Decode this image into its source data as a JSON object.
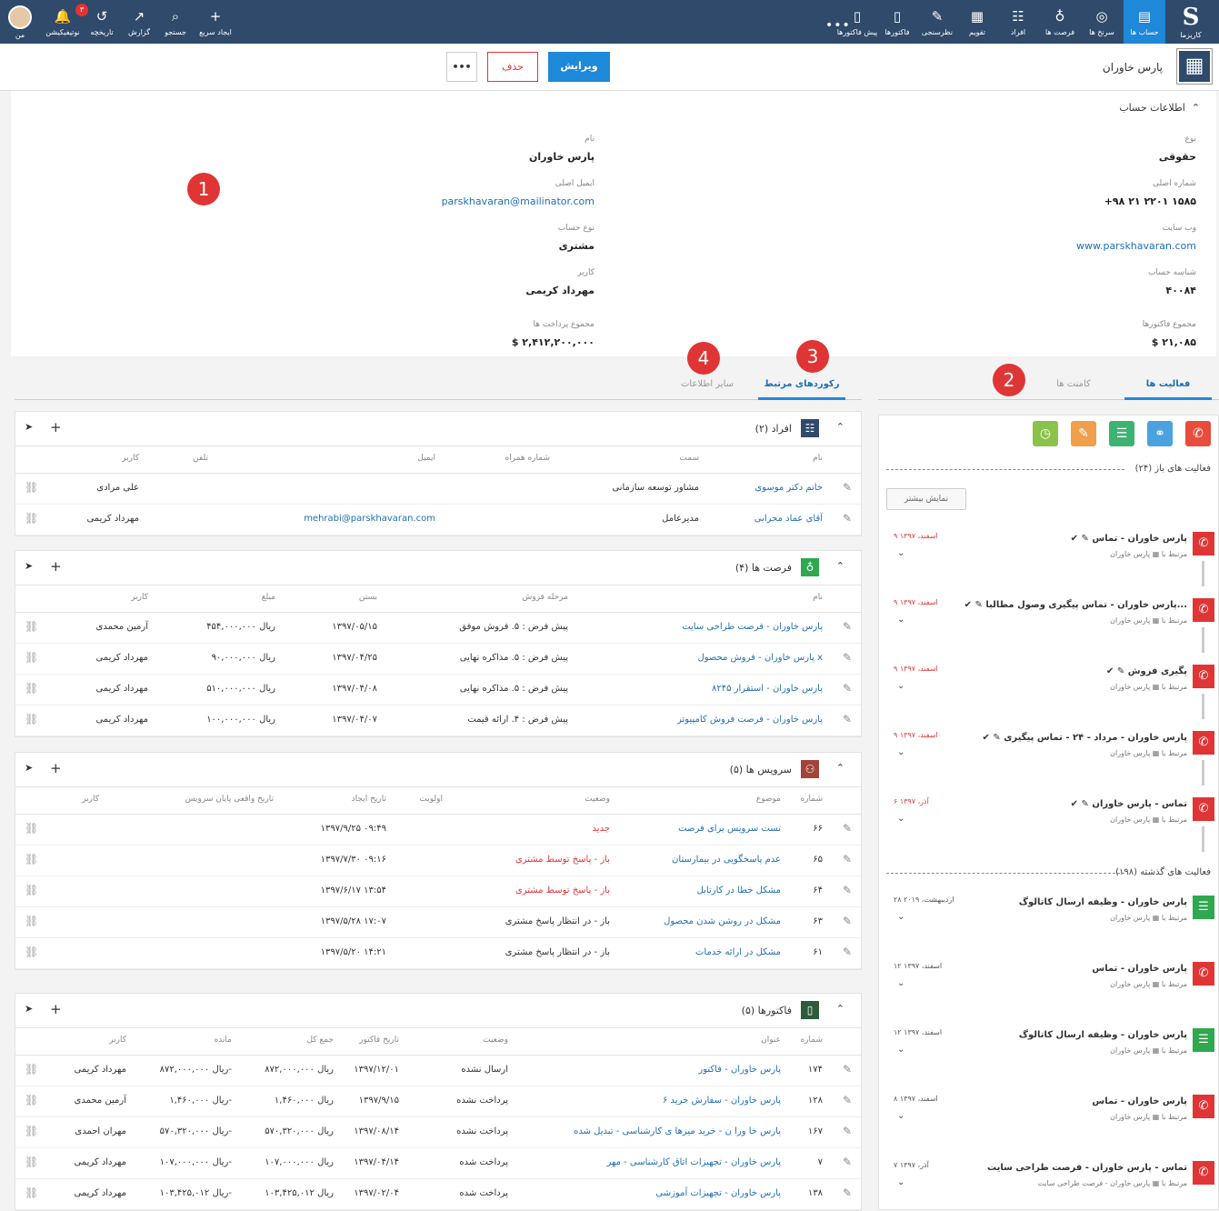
{
  "nav_right": [
    {
      "label": "کاریزما",
      "icon": "S"
    },
    {
      "label": "حساب ها",
      "icon": "▤",
      "active": true
    },
    {
      "label": "سرنخ ها",
      "icon": "◎"
    },
    {
      "label": "فرصت ها",
      "icon": "♁"
    },
    {
      "label": "افراد",
      "icon": "☷"
    },
    {
      "label": "تقویم",
      "icon": "▦"
    },
    {
      "label": "نظرسنجی",
      "icon": "✎"
    },
    {
      "label": "فاکتورها",
      "icon": "▯"
    },
    {
      "label": "پیش فاکتورها",
      "icon": "▯"
    }
  ],
  "nav_more": "•••",
  "nav_left": [
    {
      "label": "ایجاد سریع",
      "icon": "+"
    },
    {
      "label": "جستجو",
      "icon": "⌕"
    },
    {
      "label": "گزارش",
      "icon": "↗"
    },
    {
      "label": "تاریخچه",
      "icon": "↺"
    },
    {
      "label": "نوتیفیکیشن",
      "icon": "🔔",
      "badge": "۳"
    },
    {
      "label": "من",
      "icon": ""
    }
  ],
  "account": {
    "name": "پارس خاوران",
    "edit_label": "ویرایش",
    "delete_label": "حذف",
    "more_label": "•••"
  },
  "info": {
    "section_title": "اطلاعات حساب",
    "right_fields": [
      {
        "label": "نوع",
        "value": "حقوقی",
        "link": false
      },
      {
        "label": "شماره اصلی",
        "value": "+۹۸ ۲۱ ۲۲۰۱ ۱۵۸۵",
        "link": false
      },
      {
        "label": "وب سایت",
        "value": "www.parskhavaran.com",
        "link": true
      },
      {
        "label": "شناسه حساب",
        "value": "۴۰۰۸۴",
        "link": false
      },
      {
        "label": "مجموع فاکتورها",
        "value": "$ ۲۱,۰۸۵",
        "link": false
      }
    ],
    "left_fields": [
      {
        "label": "نام",
        "value": "پارس خاوران",
        "link": false
      },
      {
        "label": "ایمیل اصلی",
        "value": "parskhavaran@mailinator.com",
        "link": true
      },
      {
        "label": "نوع حساب",
        "value": "مشتری",
        "link": false
      },
      {
        "label": "کاربر",
        "value": "مهرداد کریمی",
        "link": false
      },
      {
        "label": "مجموع پرداخت ها",
        "value": "$ ۲,۴۱۲,۲۰۰,۰۰۰",
        "link": false
      }
    ]
  },
  "markers": [
    "1",
    "2",
    "3",
    "4"
  ],
  "tabs_right": {
    "activities": "فعالیت ها",
    "comments": "کامنت ها"
  },
  "tabs_left": {
    "related": "رکوردهای مرتبط",
    "other": "سایر اطلاعات"
  },
  "panels": {
    "people": {
      "title": "افراد (۲)",
      "cols": [
        "نام",
        "سمت",
        "شماره همراه",
        "ایمیل",
        "تلفن",
        "کاربر"
      ],
      "rows": [
        [
          "خانم دکتر موسوی",
          "مشاور توسعه سازمانی",
          "",
          "",
          "",
          "علی مرادی"
        ],
        [
          "آقای عماد محرابی",
          "مدیرعامل",
          "",
          "mehrabi@parskhavaran.com",
          "",
          "مهرداد کریمی"
        ]
      ]
    },
    "opps": {
      "title": "فرصت ها (۴)",
      "cols": [
        "نام",
        "مرحله فروش",
        "بستن",
        "مبلغ",
        "کاربر"
      ],
      "rows": [
        [
          "پارس خاوران - فرصت طراحی سایت",
          "پیش فرض : ۵. فروش موفق",
          "۱۳۹۷/۰۵/۱۵",
          "ریال ۴۵۴,۰۰۰,۰۰۰",
          "آرمین محمدی"
        ],
        [
          "پارس خاوران - فروش محصول x",
          "پیش فرض : ۵. مذاکره نهایی",
          "۱۳۹۷/۰۴/۲۵",
          "ریال ۹۰,۰۰۰,۰۰۰",
          "مهرداد کریمی"
        ],
        [
          "پارس خاوران - استقرار ۸۲۴۵",
          "پیش فرض : ۵. مذاکره نهایی",
          "۱۳۹۷/۰۴/۰۸",
          "ریال ۵۱۰,۰۰۰,۰۰۰",
          "مهرداد کریمی"
        ],
        [
          "پارس خاوران - فرصت فروش کامپیوتر",
          "پیش فرض : ۴. ارائه قیمت",
          "۱۳۹۷/۰۴/۰۷",
          "ریال ۱۰۰,۰۰۰,۰۰۰",
          "مهرداد کریمی"
        ]
      ]
    },
    "services": {
      "title": "سرویس ها (۵)",
      "cols": [
        "شماره",
        "موضوع",
        "وضعیت",
        "اولویت",
        "تاریخ ایجاد",
        "تاریخ واقعی پایان سرویس",
        "کاربر"
      ],
      "rows": [
        [
          "۶۶",
          "تست سرویس برای فرصت",
          "جدید",
          "",
          "۱۳۹۷/۹/۲۵ ۰۹:۴۹",
          "",
          ""
        ],
        [
          "۶۵",
          "عدم پاسخگویی در بیمارستان",
          "باز - پاسخ توسط مشتری",
          "",
          "۱۳۹۷/۷/۳۰ ۰۹:۱۶",
          "",
          ""
        ],
        [
          "۶۴",
          "مشکل خطا در کارتابل",
          "باز - پاسخ توسط مشتری",
          "",
          "۱۳۹۷/۶/۱۷ ۱۳:۵۴",
          "",
          ""
        ],
        [
          "۶۳",
          "مشکل در روشن شدن محصول",
          "باز - در انتظار پاسخ مشتری",
          "",
          "۱۳۹۷/۵/۲۸ ۱۷:۰۷",
          "",
          ""
        ],
        [
          "۶۱",
          "مشکل در ارائه خدمات",
          "باز - در انتظار پاسخ مشتری",
          "",
          "۱۳۹۷/۵/۲۰ ۱۴:۲۱",
          "",
          ""
        ]
      ],
      "red_status": [
        true,
        true,
        true,
        false,
        false
      ]
    },
    "invoices": {
      "title": "فاکتورها (۵)",
      "cols": [
        "شماره",
        "عنوان",
        "وضعیت",
        "تاریخ فاکتور",
        "جمع کل",
        "مانده",
        "کاربر"
      ],
      "rows": [
        [
          "۱۷۴",
          "پارس خاوران - فاکتور",
          "ارسال نشده",
          "۱۳۹۷/۱۲/۰۱",
          "ریال ۸۷۲,۰۰۰,۰۰۰",
          "ریال ۸۷۲,۰۰۰,۰۰۰-",
          "مهرداد کریمی"
        ],
        [
          "۱۲۸",
          "پارس خاوران - سفارش خرید ۶",
          "پرداخت نشده",
          "۱۳۹۷/۹/۱۵",
          "ریال ۱,۴۶۰,۰۰۰",
          "ریال ۱,۴۶۰,۰۰۰-",
          "آرمین محمدی"
        ],
        [
          "۱۶۷",
          "پارس خا ورا ن - خرید میزها ی کارشناسی - تبدیل شده",
          "پرداخت نشده",
          "۱۳۹۷/۰۸/۱۴",
          "ریال ۵۷۰,۳۲۰,۰۰۰",
          "ریال ۵۷۰,۳۲۰,۰۰۰-",
          "مهران احمدی"
        ],
        [
          "۷",
          "پارس خاوران - تجهیزات اتاق کارشناسی - مهر",
          "پرداخت شده",
          "۱۳۹۷/۰۴/۱۴",
          "ریال ۱۰۷,۰۰۰,۰۰۰",
          "ریال ۱۰۷,۰۰۰,۰۰۰-",
          "مهرداد کریمی"
        ],
        [
          "۱۳۸",
          "پارس خاوران - تجهیزات آموزشی",
          "پرداخت شده",
          "۱۳۹۷/۰۲/۰۴",
          "ریال ۱۰۳,۴۲۵,۰۱۲",
          "ریال ۱۰۳,۴۲۵,۰۱۲-",
          "مهرداد کریمی"
        ]
      ]
    }
  },
  "activities": {
    "open_title": "فعالیت های باز (۲۴)",
    "show_more": "نمایش بیشتر",
    "past_title": "فعالیت های گذشته (۱۹۸)",
    "related_label": "مرتبط با",
    "open": [
      {
        "title": "پارس خاوران - تماس",
        "related": "پارس خاوران",
        "date": "۹ اسفند، ۱۳۹۷",
        "type": "call"
      },
      {
        "title": "پارس خاوران - تماس پیگیری وصول مطالبا...",
        "related": "پارس خاوران",
        "date": "۹ اسفند، ۱۳۹۷",
        "type": "call"
      },
      {
        "title": "پگیری فروش",
        "related": "پارس خاوران",
        "date": "۹ اسفند، ۱۳۹۷",
        "type": "call"
      },
      {
        "title": "پارس خاوران - مرداد - ۲۴ - تماس پیگیری",
        "related": "پارس خاوران",
        "date": "۹ اسفند، ۱۳۹۷",
        "type": "call"
      },
      {
        "title": "تماس - پارس خاوران",
        "related": "پارس خاوران",
        "date": "۶ آذر، ۱۳۹۷",
        "type": "call"
      }
    ],
    "past": [
      {
        "title": "پارس خاوران - وظیفه ارسال کاتالوگ",
        "related": "پارس خاوران",
        "date": "۲۸ اردیبهشت، ۲۰۱۹",
        "type": "task"
      },
      {
        "title": "پارس خاوران - تماس",
        "related": "پارس خاوران",
        "date": "۱۲ اسفند، ۱۳۹۷",
        "type": "call"
      },
      {
        "title": "پارس خاوران - وظیفه ارسال کاتالوگ",
        "related": "پارس خاوران",
        "date": "۱۲ اسفند، ۱۳۹۷",
        "type": "task"
      },
      {
        "title": "پارس خاوران - تماس",
        "related": "پارس خاوران",
        "date": "۸ اسفند، ۱۳۹۷",
        "type": "call"
      },
      {
        "title": "تماس - پارس خاوران - فرصت طراحی سایت",
        "related": "پارس خاوران - فرصت طراحی سایت",
        "date": "۷ آذر، ۱۳۹۷",
        "type": "call"
      }
    ]
  },
  "colors": {
    "nav": "#2f4a6b",
    "accent": "#1e88d9",
    "danger": "#e03535",
    "call": "#e03535",
    "task": "#2fa84f"
  }
}
